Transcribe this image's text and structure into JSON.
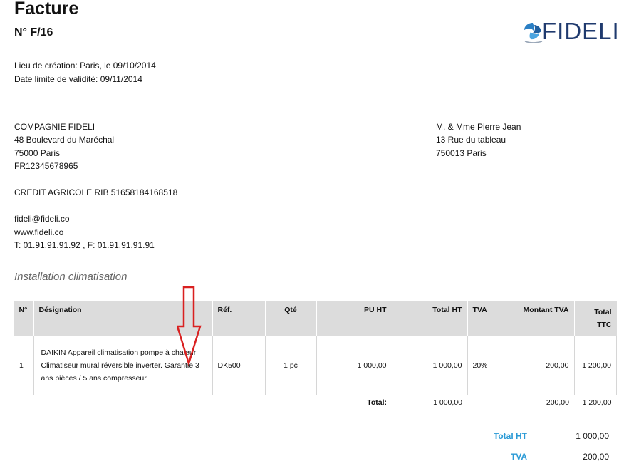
{
  "header": {
    "title": "Facture",
    "number": "N° F/16",
    "logo_text": "FIDELI"
  },
  "meta": {
    "lieu": "Lieu de création: Paris, le 09/10/2014",
    "validite": "Date limite de validité: 09/11/2014"
  },
  "sender": {
    "name": "COMPAGNIE FIDELI",
    "street": "48 Boulevard du Maréchal",
    "city": "75000 Paris",
    "vat": "FR12345678965",
    "bank": "CREDIT AGRICOLE RIB 51658184168518",
    "email": "fideli@fideli.co",
    "web": "www.fideli.co",
    "phone": "T: 01.91.91.91.92 , F: 01.91.91.91.91"
  },
  "recipient": {
    "name": "M. & Mme Pierre Jean",
    "street": "13 Rue du tableau",
    "city": "750013 Paris"
  },
  "section_title": "Installation climatisation",
  "table": {
    "headers": {
      "no": "N°",
      "designation": "Désignation",
      "ref": "Réf.",
      "qty": "Qté",
      "pu": "PU HT",
      "total_ht": "Total HT",
      "tva": "TVA",
      "montant_tva": "Montant TVA",
      "total_ttc": "Total TTC"
    },
    "rows": [
      {
        "no": "1",
        "designation_line1": "DAIKIN Appareil climatisation pompe à chaleur",
        "designation_line2": "Climatiseur mural réversible inverter. Garantie 3 ans pièces / 5 ans compresseur",
        "ref": "DK500",
        "qty": "1 pc",
        "pu": "1 000,00",
        "total_ht": "1 000,00",
        "tva": "20%",
        "montant_tva": "200,00",
        "total_ttc": "1 200,00"
      }
    ],
    "totals": {
      "label": "Total:",
      "total_ht": "1 000,00",
      "montant_tva": "200,00",
      "total_ttc": "1 200,00"
    }
  },
  "summary": {
    "total_ht_label": "Total HT",
    "total_ht_value": "1 000,00",
    "tva_label": "TVA",
    "tva_value": "200,00"
  },
  "colors": {
    "accent": "#2a9ad6",
    "logo": "#1f3a6e",
    "arrow": "#d92020"
  }
}
